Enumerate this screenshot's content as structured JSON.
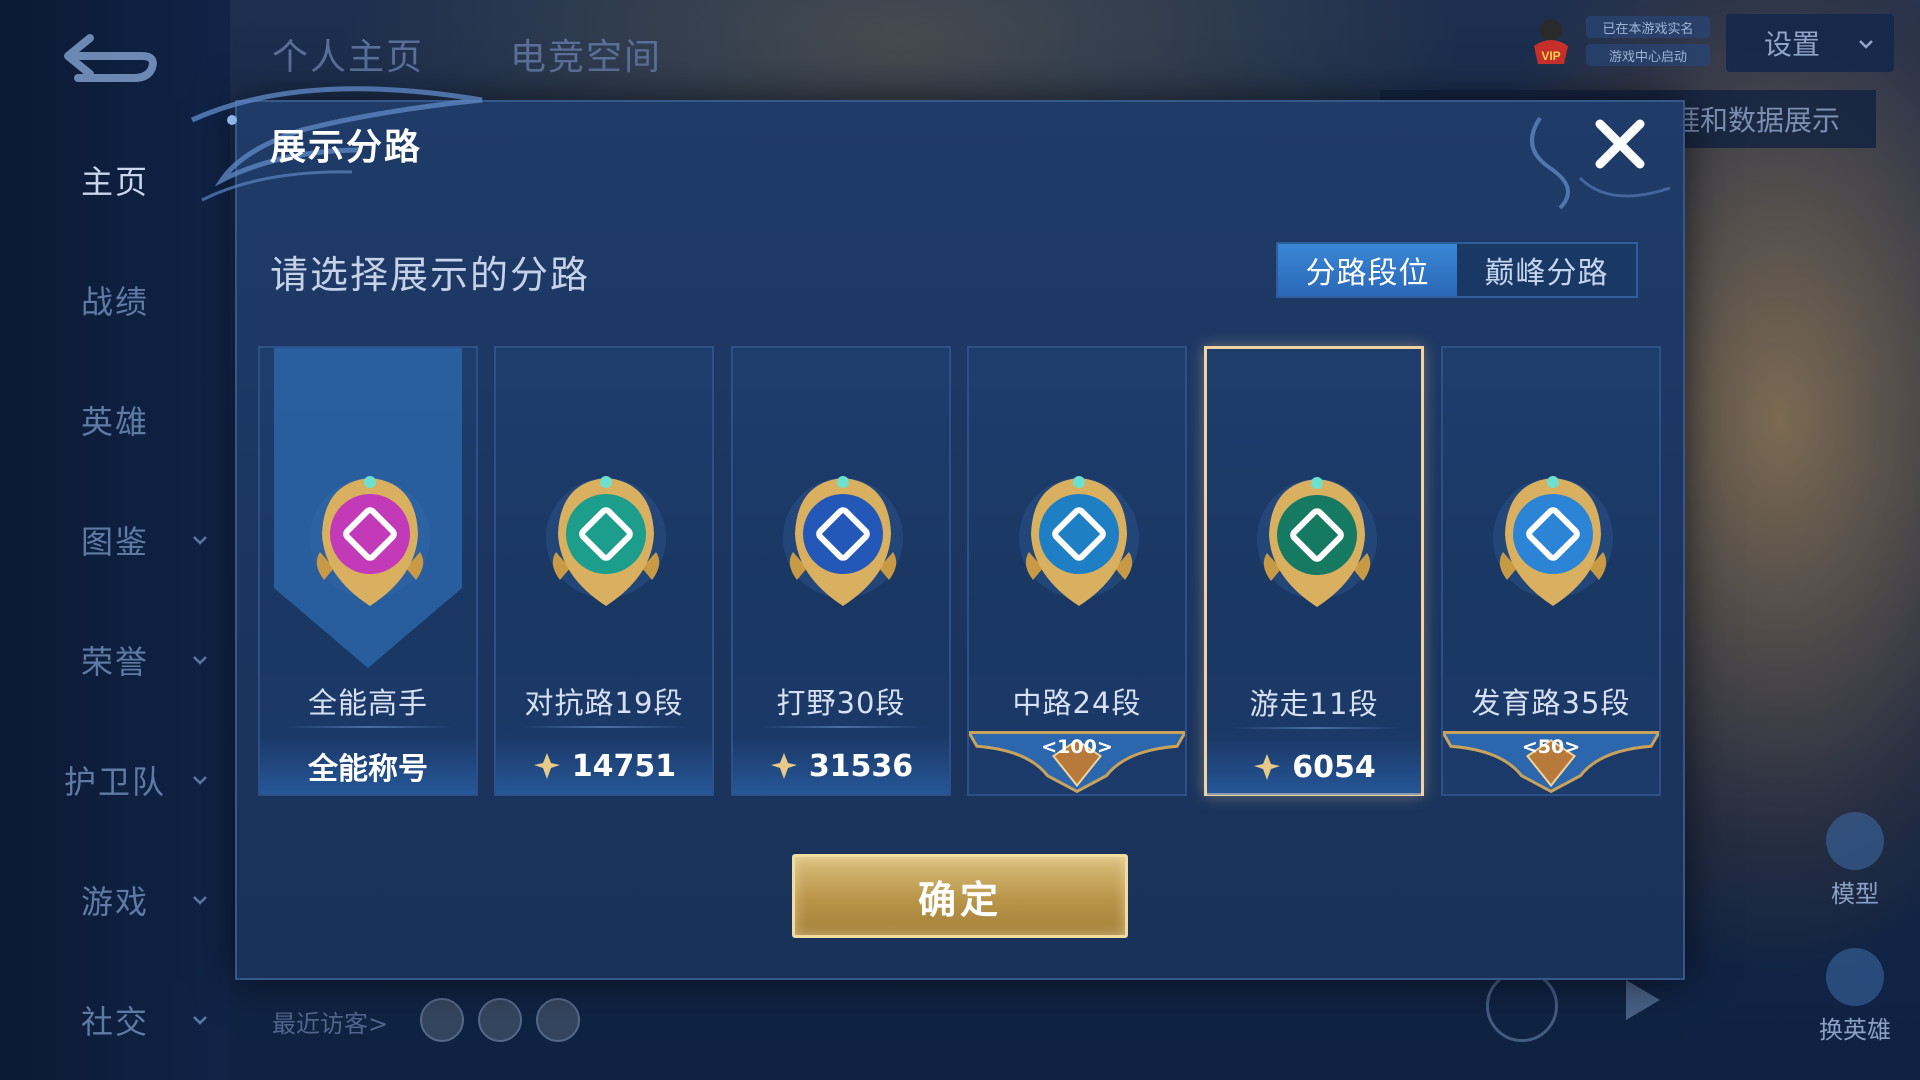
{
  "header": {
    "tabs": [
      "个人主页",
      "电竞空间"
    ],
    "status_lines": [
      "已在本游戏实名",
      "游戏中心启动"
    ],
    "vip_label": "VIP",
    "settings_label": "设置",
    "tooltip_text": "生涯和数据展示"
  },
  "sidebar": {
    "items": [
      {
        "label": "主页",
        "active": true,
        "expandable": false
      },
      {
        "label": "战绩",
        "active": false,
        "expandable": false
      },
      {
        "label": "英雄",
        "active": false,
        "expandable": false
      },
      {
        "label": "图鉴",
        "active": false,
        "expandable": true
      },
      {
        "label": "荣誉",
        "active": false,
        "expandable": true
      },
      {
        "label": "护卫队",
        "active": false,
        "expandable": true
      },
      {
        "label": "游戏",
        "active": false,
        "expandable": true
      },
      {
        "label": "社交",
        "active": false,
        "expandable": true
      }
    ]
  },
  "right_side": {
    "model_label": "模型",
    "switch_hero_label": "换英雄"
  },
  "footer": {
    "recent_visitors_label": "最近访客>"
  },
  "modal": {
    "title": "展示分路",
    "subtitle": "请选择展示的分路",
    "tabs": [
      {
        "label": "分路段位",
        "active": true
      },
      {
        "label": "巅峰分路",
        "active": false
      }
    ],
    "cards": [
      {
        "name": "全能高手",
        "footer_text": "全能称号",
        "footer_type": "text",
        "emblem_color": "#c33ab8",
        "selected": false
      },
      {
        "name": "对抗路19段",
        "footer_text": "14751",
        "footer_type": "points",
        "emblem_color": "#1d9e8c",
        "selected": false
      },
      {
        "name": "打野30段",
        "footer_text": "31536",
        "footer_type": "points",
        "emblem_color": "#2458b8",
        "selected": false
      },
      {
        "name": "中路24段",
        "footer_text": "100",
        "footer_type": "crest",
        "emblem_color": "#1f7fc4",
        "selected": false
      },
      {
        "name": "游走11段",
        "footer_text": "6054",
        "footer_type": "points",
        "emblem_color": "#167a63",
        "selected": true
      },
      {
        "name": "发育路35段",
        "footer_text": "50",
        "footer_type": "crest",
        "emblem_color": "#2b84d6",
        "selected": false
      }
    ],
    "confirm_label": "确定"
  },
  "colors": {
    "accent_blue": "#3a86d6",
    "gold": "#d9c07c",
    "selected_border": "#f2d2a0"
  }
}
